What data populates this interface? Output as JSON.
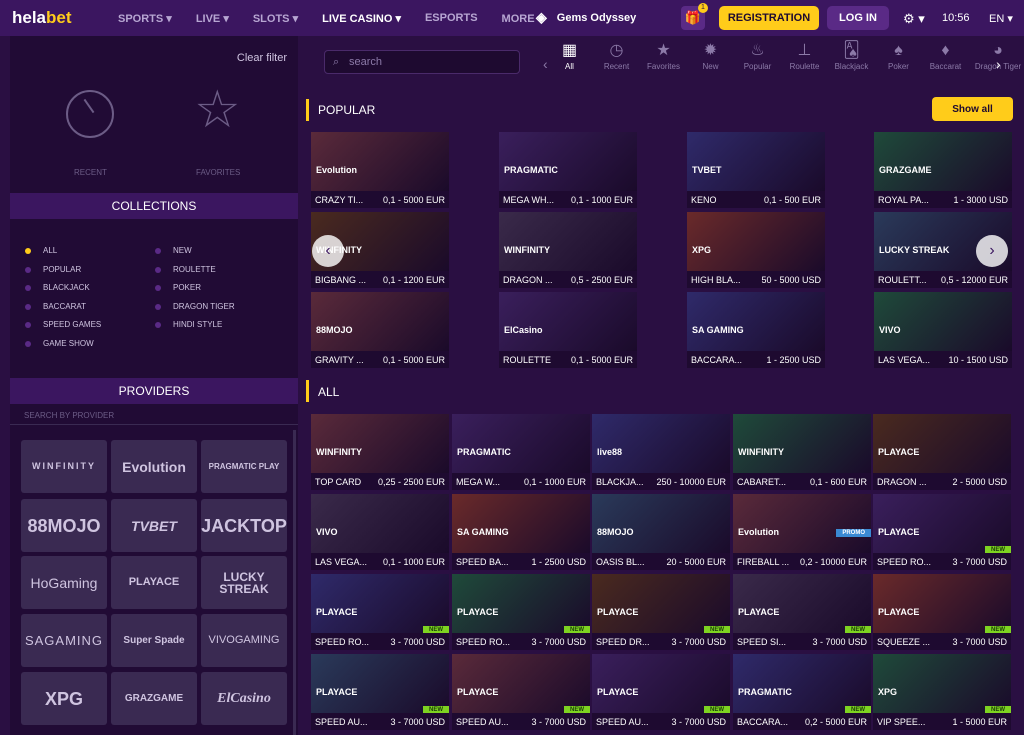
{
  "brand": {
    "part1": "hela",
    "part2": "bet"
  },
  "nav": [
    "SPORTS",
    "LIVE",
    "SLOTS",
    "LIVE CASINO",
    "ESPORTS",
    "MORE"
  ],
  "gems": "Gems Odyssey",
  "gift_badge": "1",
  "registration": "REGISTRATION",
  "login": "LOG IN",
  "time": "10:56",
  "lang": "EN",
  "sidebar": {
    "clear": "Clear filter",
    "recent": "RECENT",
    "favorites": "FAVORITES",
    "collections_title": "COLLECTIONS",
    "collections_left": [
      "ALL",
      "POPULAR",
      "BLACKJACK",
      "BACCARAT",
      "SPEED GAMES",
      "GAME SHOW"
    ],
    "collections_right": [
      "NEW",
      "ROULETTE",
      "POKER",
      "DRAGON TIGER",
      "HINDI STYLE"
    ],
    "providers_title": "PROVIDERS",
    "search_provider": "SEARCH BY PROVIDER",
    "providers": [
      "WINFINITY",
      "Evolution",
      "PRAGMATIC PLAY",
      "88MOJO",
      "TVBET",
      "JACKTOP",
      "HoGaming",
      "PLAYACE",
      "LUCKY STREAK",
      "SAGAMING",
      "Super Spade",
      "VIVOGAMING",
      "XPG",
      "GRAZGAME",
      "ElCasino"
    ]
  },
  "search_placeholder": "search",
  "categories": [
    "All",
    "Recent",
    "Favorites",
    "New",
    "Popular",
    "Roulette",
    "Blackjack",
    "Poker",
    "Baccarat",
    "Dragon Tiger"
  ],
  "popular_title": "POPULAR",
  "show_all": "Show all",
  "popular": [
    {
      "name": "CRAZY TI...",
      "limit": "0,1 - 5000 EUR",
      "brand": "Evolution"
    },
    {
      "name": "MEGA WH...",
      "limit": "0,1 - 1000 EUR",
      "brand": "PRAGMATIC"
    },
    {
      "name": "KENO",
      "limit": "0,1 - 500 EUR",
      "brand": "TVBET"
    },
    {
      "name": "ROYAL PA...",
      "limit": "1 - 3000 USD",
      "brand": "GRAZGAME"
    },
    {
      "name": "BIGBANG ...",
      "limit": "0,1 - 1200 EUR",
      "brand": "WINFINITY"
    },
    {
      "name": "DRAGON ...",
      "limit": "0,5 - 2500 EUR",
      "brand": "WINFINITY"
    },
    {
      "name": "HIGH BLA...",
      "limit": "50 - 5000 USD",
      "brand": "XPG"
    },
    {
      "name": "ROULETT...",
      "limit": "0,5 - 12000 EUR",
      "brand": "LUCKY STREAK"
    },
    {
      "name": "GRAVITY ...",
      "limit": "0,1 - 5000 EUR",
      "brand": "88MOJO"
    },
    {
      "name": "ROULETTE",
      "limit": "0,1 - 5000 EUR",
      "brand": "ElCasino"
    },
    {
      "name": "BACCARA...",
      "limit": "1 - 2500 USD",
      "brand": "SA GAMING"
    },
    {
      "name": "LAS VEGA...",
      "limit": "10 - 1500 USD",
      "brand": "VIVO"
    }
  ],
  "all_title": "ALL",
  "all": [
    {
      "name": "TOP CARD",
      "limit": "0,25 - 2500 EUR",
      "brand": "WINFINITY"
    },
    {
      "name": "MEGA W...",
      "limit": "0,1 - 1000 EUR",
      "brand": "PRAGMATIC"
    },
    {
      "name": "BLACKJA...",
      "limit": "250 - 10000 EUR",
      "brand": "live88"
    },
    {
      "name": "CABARET...",
      "limit": "0,1 - 600 EUR",
      "brand": "WINFINITY"
    },
    {
      "name": "DRAGON ...",
      "limit": "2 - 5000 USD",
      "brand": "PLAYACE"
    },
    {
      "name": "LAS VEGA...",
      "limit": "0,1 - 1000 EUR",
      "brand": "VIVO"
    },
    {
      "name": "SPEED BA...",
      "limit": "1 - 2500 USD",
      "brand": "SA GAMING"
    },
    {
      "name": "OASIS BL...",
      "limit": "20 - 5000 EUR",
      "brand": "88MOJO"
    },
    {
      "name": "FIREBALL ...",
      "limit": "0,2 - 10000 EUR",
      "brand": "Evolution",
      "tag": "PROMO"
    },
    {
      "name": "SPEED RO...",
      "limit": "3 - 7000 USD",
      "brand": "PLAYACE",
      "tag": "NEW"
    },
    {
      "name": "SPEED RO...",
      "limit": "3 - 7000 USD",
      "brand": "PLAYACE",
      "tag": "NEW"
    },
    {
      "name": "SPEED RO...",
      "limit": "3 - 7000 USD",
      "brand": "PLAYACE",
      "tag": "NEW"
    },
    {
      "name": "SPEED DR...",
      "limit": "3 - 7000 USD",
      "brand": "PLAYACE",
      "tag": "NEW"
    },
    {
      "name": "SPEED SI...",
      "limit": "3 - 7000 USD",
      "brand": "PLAYACE",
      "tag": "NEW"
    },
    {
      "name": "SQUEEZE ...",
      "limit": "3 - 7000 USD",
      "brand": "PLAYACE",
      "tag": "NEW"
    },
    {
      "name": "SPEED AU...",
      "limit": "3 - 7000 USD",
      "brand": "PLAYACE",
      "tag": "NEW"
    },
    {
      "name": "SPEED AU...",
      "limit": "3 - 7000 USD",
      "brand": "PLAYACE",
      "tag": "NEW"
    },
    {
      "name": "SPEED AU...",
      "limit": "3 - 7000 USD",
      "brand": "PLAYACE",
      "tag": "NEW"
    },
    {
      "name": "BACCARA...",
      "limit": "0,2 - 5000 EUR",
      "brand": "PRAGMATIC",
      "tag": "NEW"
    },
    {
      "name": "VIP SPEE...",
      "limit": "1 - 5000 EUR",
      "brand": "XPG",
      "tag": "NEW"
    }
  ]
}
